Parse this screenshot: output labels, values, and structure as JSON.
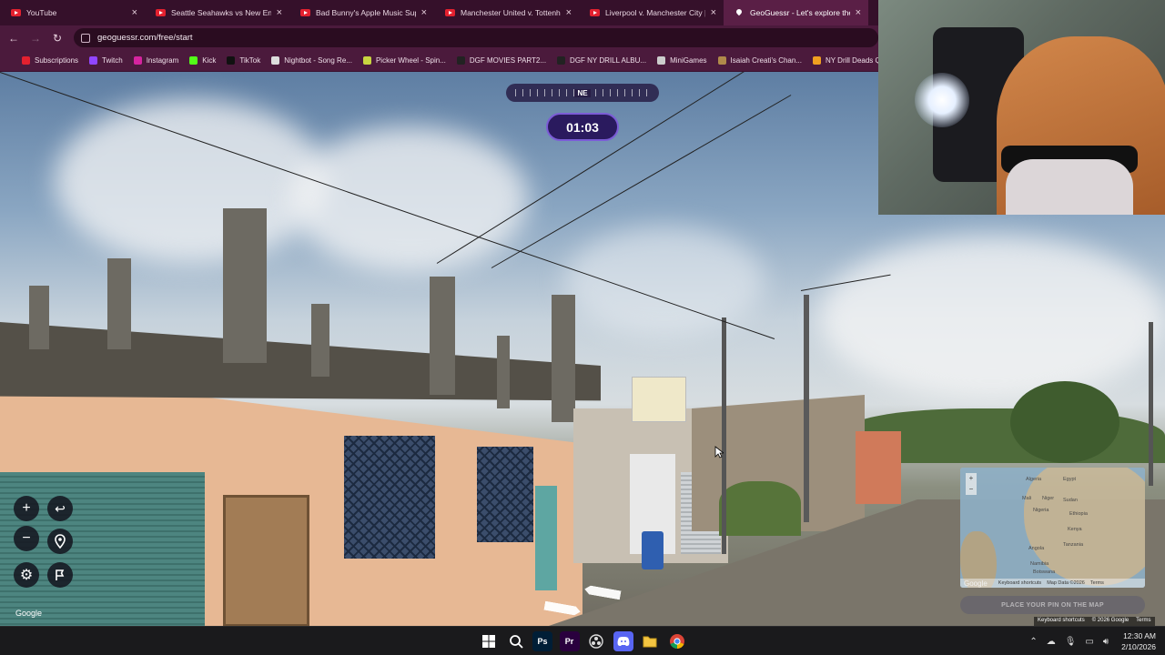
{
  "browser": {
    "tabs": [
      {
        "title": "YouTube",
        "active": false
      },
      {
        "title": "Seattle Seahawks vs New Engla",
        "active": false
      },
      {
        "title": "Bad Bunny's Apple Music Super",
        "active": false
      },
      {
        "title": "Manchester United v. Tottenha",
        "active": false
      },
      {
        "title": "Liverpool v. Manchester City | P",
        "active": false
      },
      {
        "title": "GeoGuessr - Let's explore the w",
        "active": true
      }
    ],
    "close_glyph": "×",
    "url": "geoguessr.com/free/start",
    "bookmarks": [
      {
        "label": "Subscriptions",
        "color": "#e3212f"
      },
      {
        "label": "Twitch",
        "color": "#9146ff"
      },
      {
        "label": "Instagram",
        "color": "#d6249f"
      },
      {
        "label": "Kick",
        "color": "#53fc18"
      },
      {
        "label": "TikTok",
        "color": "#111111"
      },
      {
        "label": "Nightbot - Song Re...",
        "color": "#dddddd"
      },
      {
        "label": "Picker Wheel - Spin...",
        "color": "#c8d640"
      },
      {
        "label": "DGF MOVIES PART2...",
        "color": "#222222"
      },
      {
        "label": "DGF NY DRILL ALBU...",
        "color": "#222222"
      },
      {
        "label": "MiniGames",
        "color": "#cccccc"
      },
      {
        "label": "Isaiah Creati's Chan...",
        "color": "#b08a4a"
      },
      {
        "label": "NY Drill Deads Q",
        "color": "#f0a020"
      }
    ]
  },
  "game": {
    "compass_direction": "NE",
    "timer": "01:03",
    "google_label": "Google",
    "place_pin_label": "PLACE YOUR PIN ON THE MAP",
    "map": {
      "labels": [
        "Algeria",
        "Egypt",
        "Mali",
        "Niger",
        "Sudan",
        "Nigeria",
        "Ethiopia",
        "Kenya",
        "Tanzania",
        "Angola",
        "Namibia",
        "Botswana"
      ],
      "footer": [
        "Keyboard shortcuts",
        "Map Data ©2026",
        "Terms"
      ],
      "zoom_in": "+",
      "zoom_out": "−"
    },
    "street_attr": [
      "Keyboard shortcuts",
      "© 2026 Google",
      "Terms"
    ]
  },
  "taskbar": {
    "time": "12:30 AM",
    "date": "2/10/2026",
    "apps": [
      {
        "name": "start",
        "color": "#3aa0ff"
      },
      {
        "name": "search",
        "color": "transparent"
      },
      {
        "name": "photoshop",
        "color": "#001e36",
        "label": "Ps"
      },
      {
        "name": "premiere",
        "color": "#2a003e",
        "label": "Pr"
      },
      {
        "name": "obs",
        "color": "transparent"
      },
      {
        "name": "discord",
        "color": "#5865f2"
      },
      {
        "name": "file-explorer",
        "color": "#f4c542"
      },
      {
        "name": "chrome",
        "color": "#db4437"
      }
    ]
  }
}
